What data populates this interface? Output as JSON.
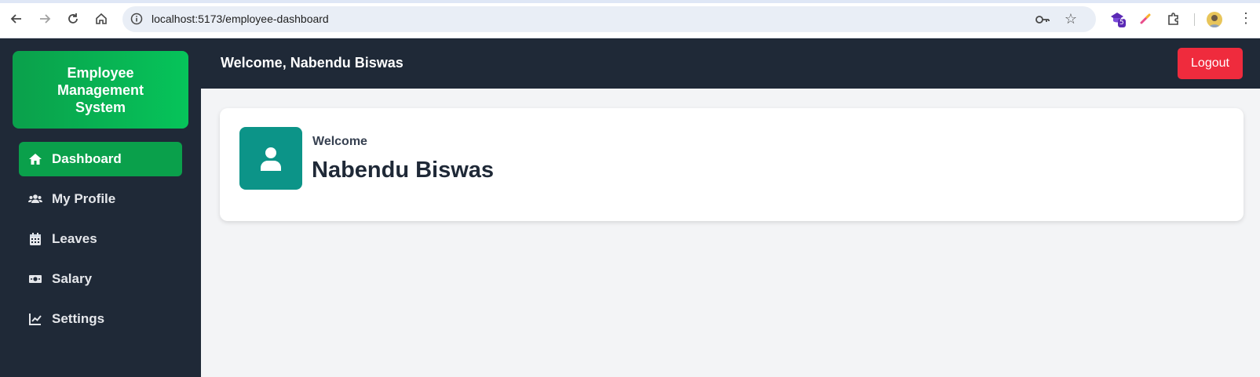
{
  "browser": {
    "url": "localhost:5173/employee-dashboard",
    "extension_badge": "5",
    "icons": [
      "back-icon",
      "forward-icon",
      "reload-icon",
      "home-icon",
      "site-info-icon",
      "password-key-icon",
      "bookmark-star-icon",
      "extension-icon",
      "color-picker-icon",
      "puzzle-extensions-icon",
      "profile-avatar",
      "more-menu-icon"
    ]
  },
  "sidebar": {
    "brand": "Employee Management System",
    "items": [
      {
        "label": "Dashboard",
        "icon": "home-icon",
        "active": true
      },
      {
        "label": "My Profile",
        "icon": "users-icon",
        "active": false
      },
      {
        "label": "Leaves",
        "icon": "calendar-icon",
        "active": false
      },
      {
        "label": "Salary",
        "icon": "money-bill-icon",
        "active": false
      },
      {
        "label": "Settings",
        "icon": "chart-line-icon",
        "active": false
      }
    ]
  },
  "header": {
    "title": "Welcome, Nabendu Biswas",
    "logout_label": "Logout"
  },
  "card": {
    "label": "Welcome",
    "name": "Nabendu Biswas",
    "icon": "user-icon"
  },
  "colors": {
    "sidebar_bg": "#1f2937",
    "accent_green": "#0aa04b",
    "logout_red": "#ef2b3d",
    "teal_icon": "#0c9488",
    "page_bg": "#f3f4f6"
  }
}
